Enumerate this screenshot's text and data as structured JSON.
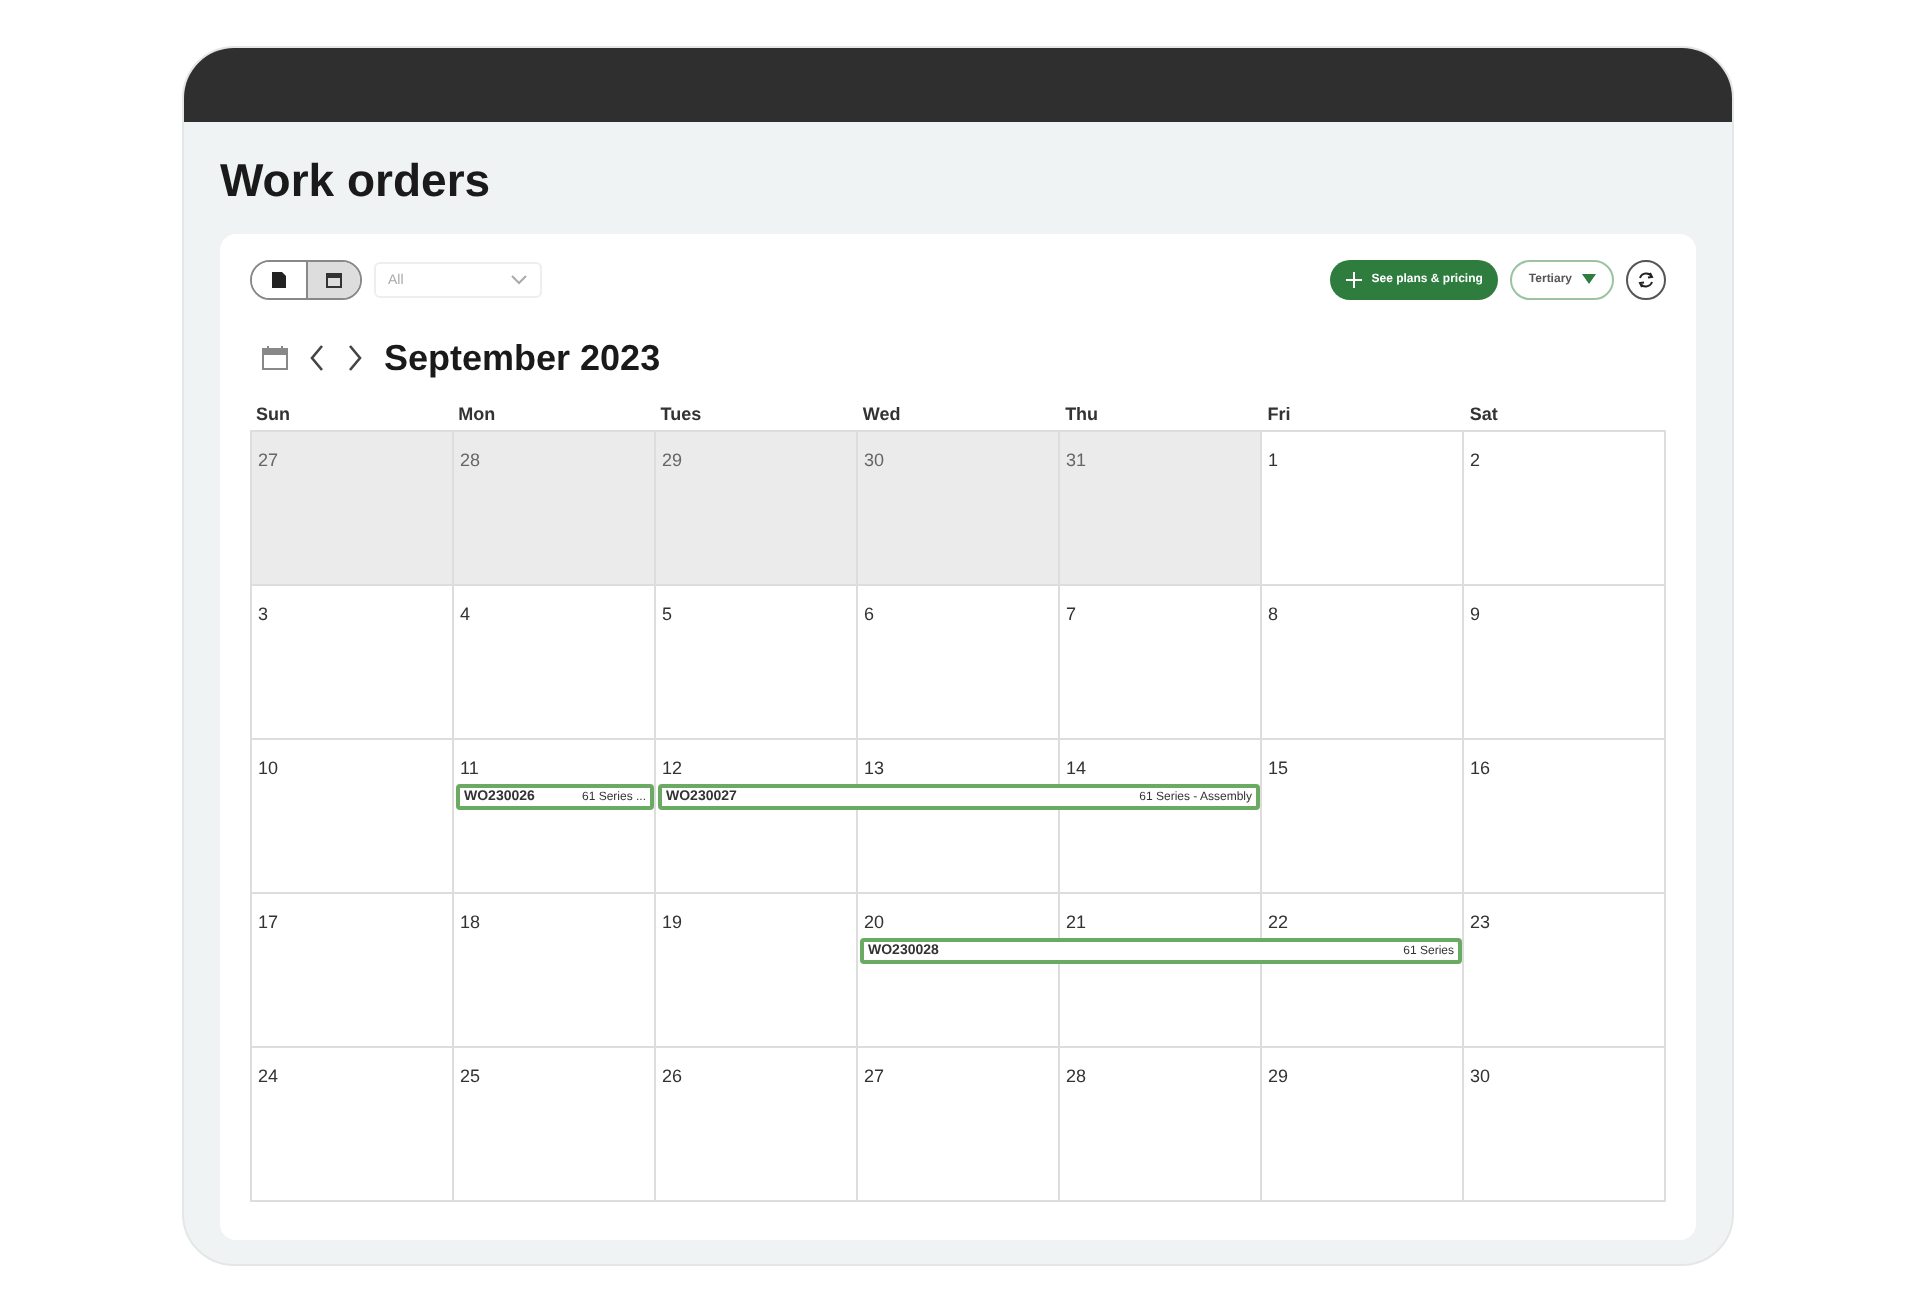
{
  "page": {
    "title": "Work orders"
  },
  "toolbar": {
    "views": [
      {
        "kind": "list",
        "selected": false
      },
      {
        "kind": "calendar",
        "selected": true
      }
    ],
    "filter": {
      "value": "All"
    },
    "primary_button": "See plans & pricing",
    "tertiary_button": "Tertiary"
  },
  "calendar": {
    "month": "September 2023",
    "weekdays": [
      "Sun",
      "Mon",
      "Tues",
      "Wed",
      "Thu",
      "Fri",
      "Sat"
    ],
    "weeks": [
      {
        "days": [
          {
            "label": "27",
            "outside": true
          },
          {
            "label": "28",
            "outside": true
          },
          {
            "label": "29",
            "outside": true
          },
          {
            "label": "30",
            "outside": true
          },
          {
            "label": "31",
            "outside": true
          },
          {
            "label": "1",
            "outside": false
          },
          {
            "label": "2",
            "outside": false
          }
        ]
      },
      {
        "days": [
          {
            "label": "3",
            "outside": false
          },
          {
            "label": "4",
            "outside": false
          },
          {
            "label": "5",
            "outside": false
          },
          {
            "label": "6",
            "outside": false
          },
          {
            "label": "7",
            "outside": false
          },
          {
            "label": "8",
            "outside": false
          },
          {
            "label": "9",
            "outside": false
          }
        ]
      },
      {
        "days": [
          {
            "label": "10",
            "outside": false
          },
          {
            "label": "11",
            "outside": false,
            "events": [
              {
                "id": "WO230026",
                "title": "61 Series ..."
              }
            ]
          },
          {
            "label": "12",
            "outside": false,
            "spanned": false,
            "events": [
              {
                "id": "WO230027",
                "title": "61 Series - Assembly"
              }
            ]
          },
          {
            "label": "13",
            "outside": false,
            "spanned": true
          },
          {
            "label": "14",
            "outside": false,
            "spanned": true
          },
          {
            "label": "15",
            "outside": false,
            "spanned": false
          },
          {
            "label": "16",
            "outside": false
          }
        ]
      },
      {
        "days": [
          {
            "label": "17",
            "outside": false
          },
          {
            "label": "18",
            "outside": false
          },
          {
            "label": "19",
            "outside": false
          },
          {
            "label": "20",
            "outside": false,
            "events": [
              {
                "id": "WO230028",
                "title": "61 Series"
              }
            ]
          },
          {
            "label": "21",
            "outside": false,
            "spanned": true
          },
          {
            "label": "22",
            "outside": false,
            "spanned": true
          },
          {
            "label": "23",
            "outside": false
          }
        ]
      },
      {
        "days": [
          {
            "label": "24",
            "outside": false
          },
          {
            "label": "25",
            "outside": false
          },
          {
            "label": "26",
            "outside": false
          },
          {
            "label": "27",
            "outside": false
          },
          {
            "label": "28",
            "outside": false
          },
          {
            "label": "29",
            "outside": false
          },
          {
            "label": "30",
            "outside": false
          }
        ]
      }
    ]
  }
}
